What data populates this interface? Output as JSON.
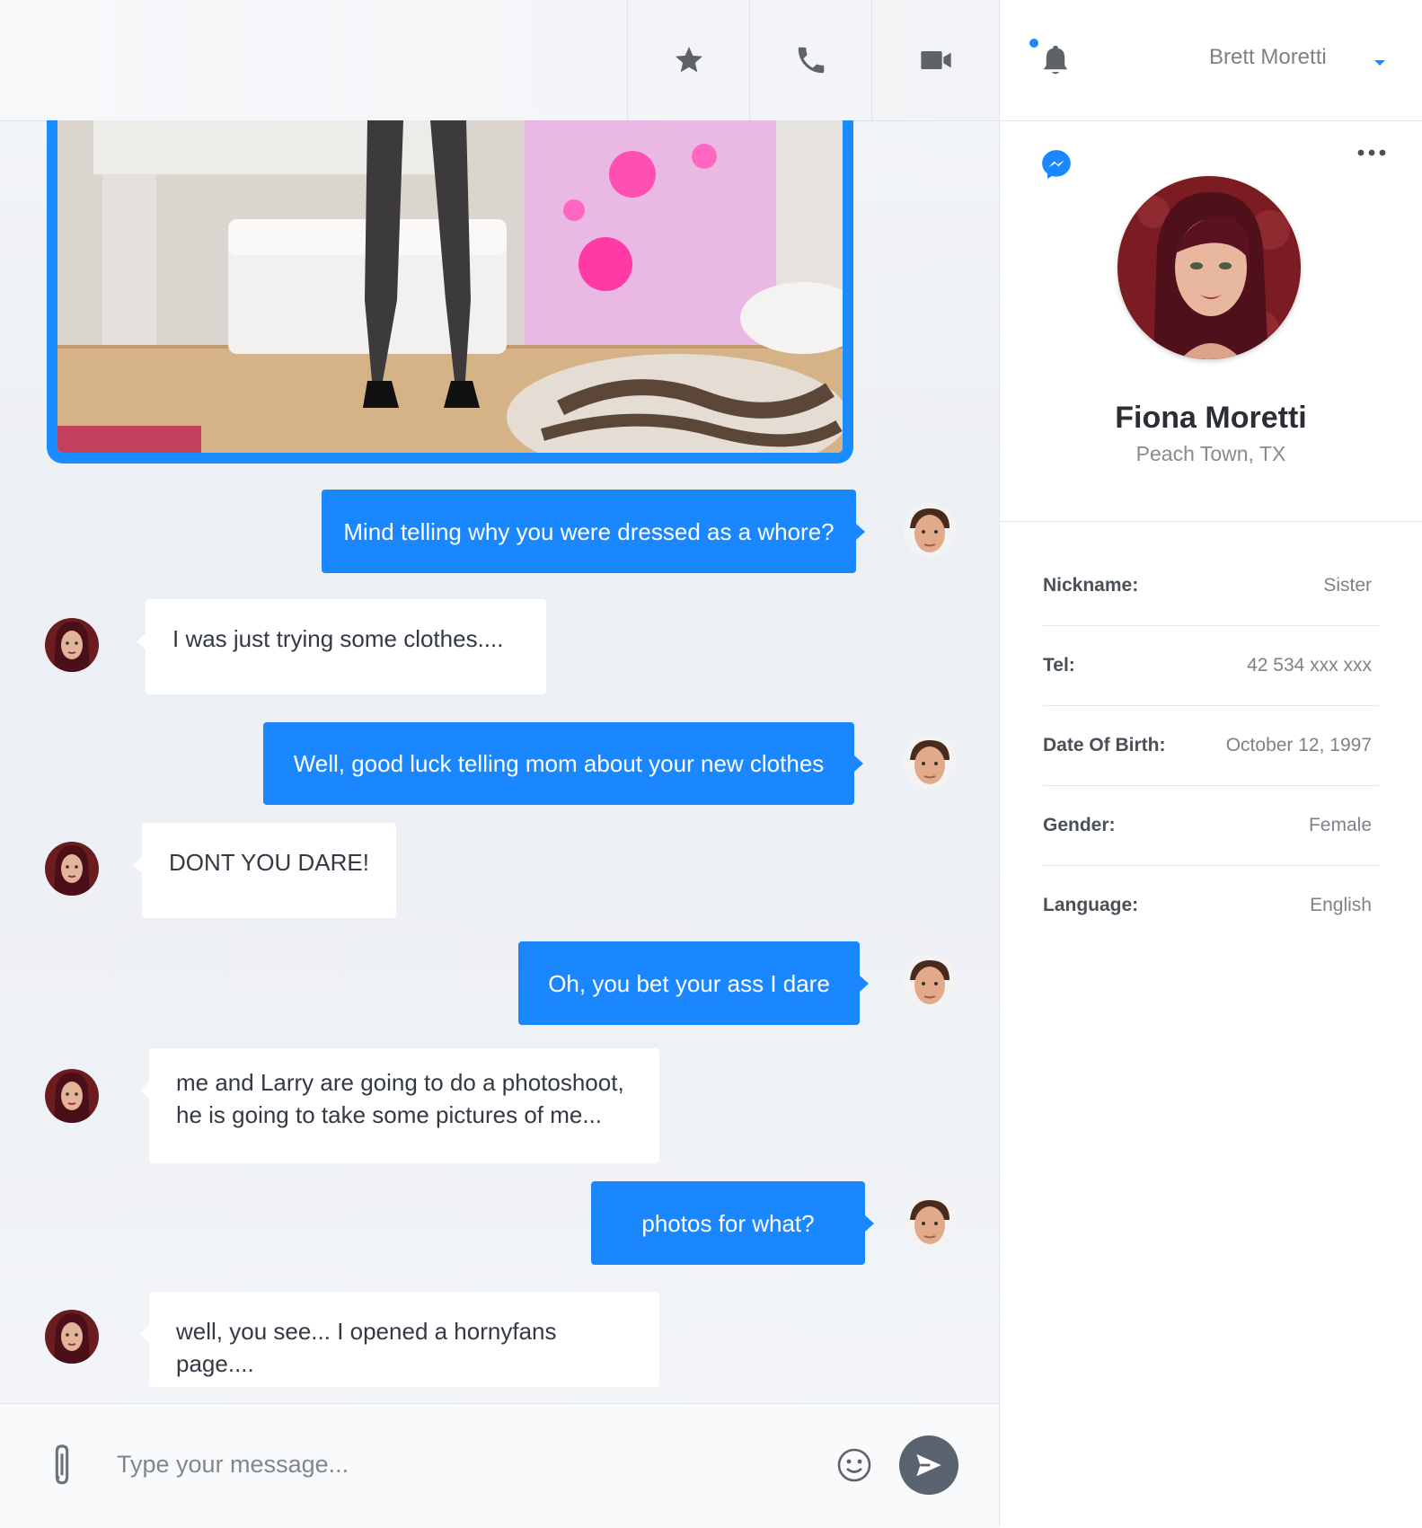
{
  "header": {
    "icons": {
      "favorite": "star-icon",
      "call": "phone-icon",
      "video": "video-camera-icon"
    }
  },
  "messages": [
    {
      "dir": "out",
      "text": "Mind telling why you were dressed as a whore?"
    },
    {
      "dir": "in",
      "text": "I was just trying some clothes...."
    },
    {
      "dir": "out",
      "text": "Well, good luck telling mom about your new clothes"
    },
    {
      "dir": "in",
      "text": "DONT YOU DARE!"
    },
    {
      "dir": "out",
      "text": "Oh, you bet your ass I dare"
    },
    {
      "dir": "in",
      "text": "me and Larry are going to do a photoshoot,\nhe is going to take some pictures of me..."
    },
    {
      "dir": "out",
      "text": "photos for what?"
    },
    {
      "dir": "in",
      "text": "well, you see... I opened a hornyfans page...."
    }
  ],
  "composer": {
    "placeholder": "Type your message...",
    "icons": {
      "attach": "paperclip-icon",
      "emoji": "smiley-icon",
      "send": "send-icon"
    }
  },
  "topbar": {
    "user_name": "Brett Moretti",
    "has_notification": true
  },
  "profile": {
    "name": "Fiona Moretti",
    "location": "Peach Town, TX",
    "details": [
      {
        "label": "Nickname:",
        "value": "Sister"
      },
      {
        "label": "Tel:",
        "value": "42 534 xxx xxx"
      },
      {
        "label": "Date Of Birth:",
        "value": "October 12, 1997"
      },
      {
        "label": "Gender:",
        "value": "Female"
      },
      {
        "label": "Language:",
        "value": "English"
      }
    ]
  },
  "colors": {
    "accent": "#1a87ff",
    "incoming_bubble": "#ffffff",
    "send_button": "#5a6470"
  }
}
